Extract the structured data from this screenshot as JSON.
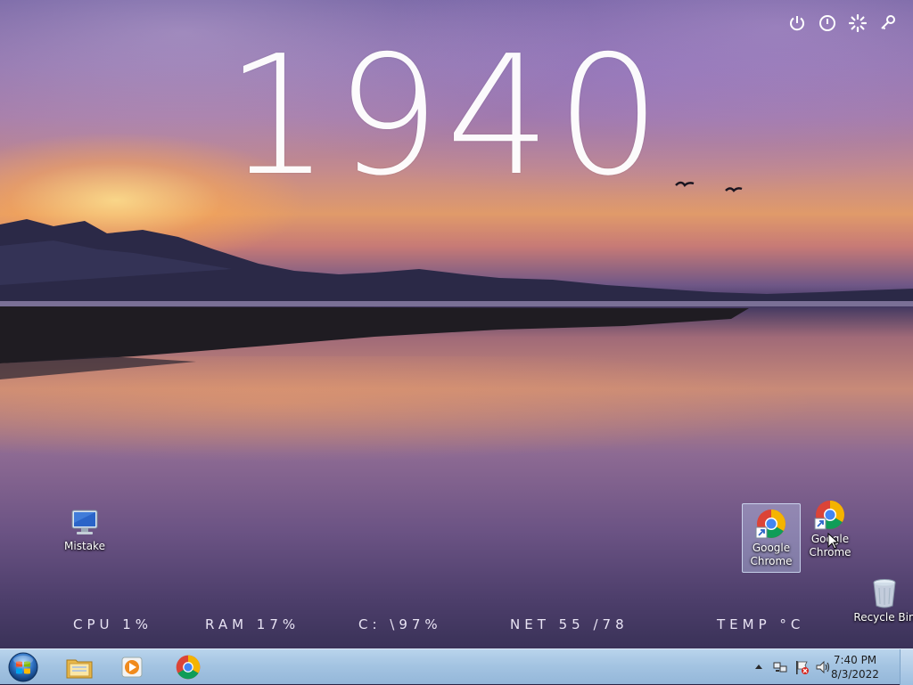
{
  "clock": {
    "time": "1940"
  },
  "top_icons": [
    "power-icon",
    "info-icon",
    "settings-icon",
    "key-icon"
  ],
  "desktop": {
    "icons": [
      {
        "name": "mistake",
        "label": "Mistake",
        "icon": "computer-icon"
      },
      {
        "name": "google-chrome-1",
        "label_line1": "Google",
        "label_line2": "Chrome",
        "icon": "chrome-icon",
        "selected": true
      },
      {
        "name": "google-chrome-2",
        "label_line1": "Google",
        "label_line2": "Chrome",
        "icon": "chrome-icon",
        "selected": false
      },
      {
        "name": "recycle-bin",
        "label": "Recycle Bin",
        "icon": "recycle-bin-icon"
      }
    ]
  },
  "stats": {
    "cpu": "CPU 1%",
    "ram": "RAM 17%",
    "disk": "C: \\97%",
    "net": "NET 55 /78",
    "temp": "TEMP °C"
  },
  "taskbar": {
    "pinned": [
      "windows-explorer-icon",
      "media-player-icon",
      "chrome-icon"
    ],
    "tray": {
      "time": "7:40 PM",
      "date": "8/3/2022"
    }
  },
  "colors": {
    "taskbar_top": "#b9d4ec",
    "taskbar_bottom": "#94b7d9",
    "text_white": "#ffffff"
  }
}
